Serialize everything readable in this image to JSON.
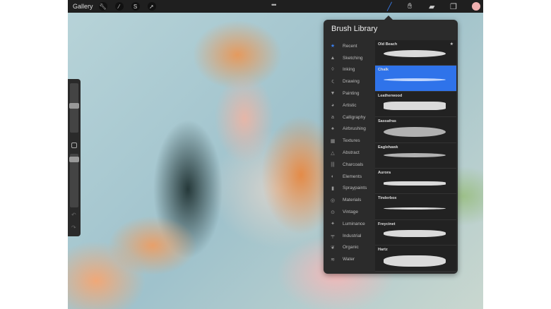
{
  "topbar": {
    "gallery": "Gallery",
    "tools": [
      "wrench-icon",
      "magic-wand-icon",
      "selection-icon",
      "transform-arrow-icon"
    ],
    "more": "•••",
    "right_tools": [
      "brush-icon",
      "smudge-icon",
      "eraser-icon",
      "layers-icon"
    ],
    "current_color": "#f0b0b0"
  },
  "panel": {
    "title": "Brush Library",
    "categories": [
      {
        "label": "Recent",
        "icon": "★"
      },
      {
        "label": "Sketching",
        "icon": "▲"
      },
      {
        "label": "Inking",
        "icon": "◊"
      },
      {
        "label": "Drawing",
        "icon": "ς"
      },
      {
        "label": "Painting",
        "icon": "▼"
      },
      {
        "label": "Artistic",
        "icon": "◕"
      },
      {
        "label": "Calligraphy",
        "icon": "a"
      },
      {
        "label": "Airbrushing",
        "icon": "♠"
      },
      {
        "label": "Textures",
        "icon": "▦"
      },
      {
        "label": "Abstract",
        "icon": "△"
      },
      {
        "label": "Charcoals",
        "icon": "|||"
      },
      {
        "label": "Elements",
        "icon": "◐"
      },
      {
        "label": "Spraypaints",
        "icon": "▮"
      },
      {
        "label": "Materials",
        "icon": "◎"
      },
      {
        "label": "Vintage",
        "icon": "⊙"
      },
      {
        "label": "Luminance",
        "icon": "✦"
      },
      {
        "label": "Industrial",
        "icon": "╤"
      },
      {
        "label": "Organic",
        "icon": "❦"
      },
      {
        "label": "Water",
        "icon": "≋"
      }
    ],
    "brushes": [
      "Old Beach",
      "Chalk",
      "Leatherwood",
      "Sassafras",
      "Eaglehawk",
      "Aurora",
      "Tinderbox",
      "Freycinet",
      "Hartz"
    ]
  },
  "accent": "#2f73ea"
}
